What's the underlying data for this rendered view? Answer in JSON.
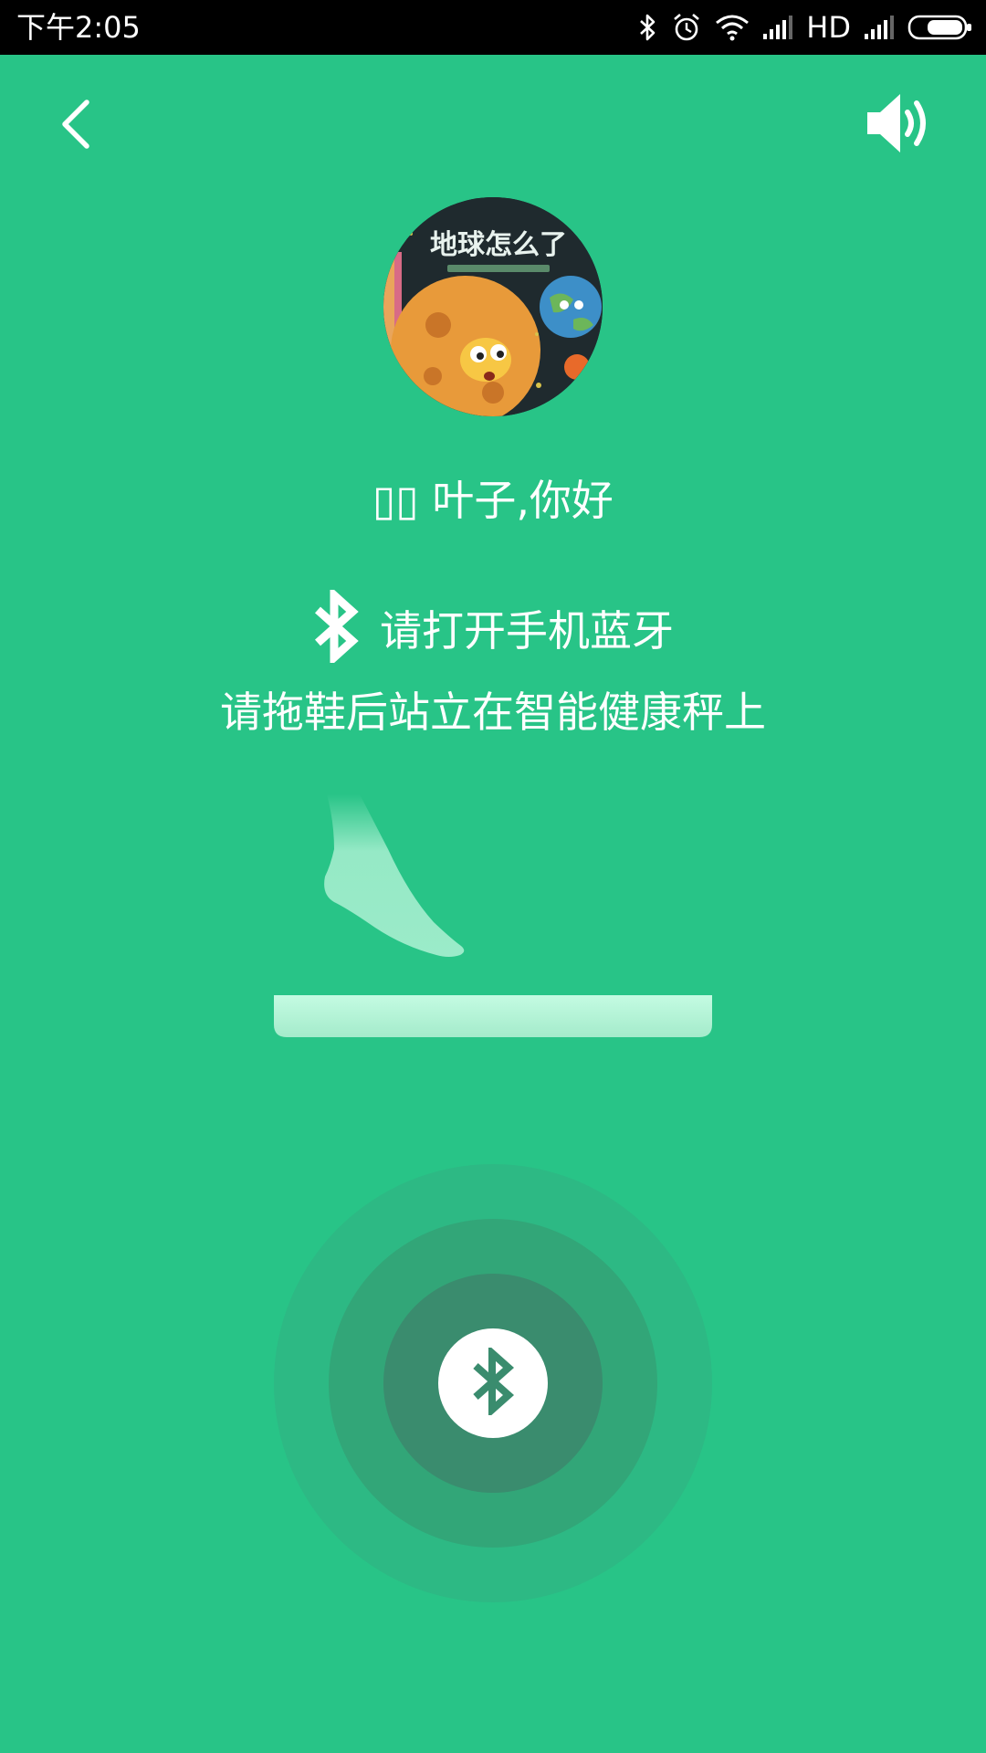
{
  "status_bar": {
    "time": "下午2:05",
    "network_label": "HD",
    "icons": [
      "bluetooth-icon",
      "alarm-icon",
      "wifi-icon",
      "signal-icon",
      "signal-icon",
      "battery-icon"
    ]
  },
  "nav": {
    "back_icon": "back-arrow-icon",
    "volume_icon": "speaker-icon"
  },
  "avatar": {
    "book_title": "地球怎么了"
  },
  "greeting": {
    "prefix": "▯▯",
    "text": "叶子,你好"
  },
  "bluetooth_prompt": {
    "icon": "bluetooth-icon",
    "text": "请打开手机蓝牙"
  },
  "instruction": "请拖鞋后站立在智能健康秤上",
  "center_button": {
    "icon": "bluetooth-icon"
  },
  "colors": {
    "background": "#28C487",
    "pulse_outer": "#2DB984",
    "pulse_middle": "#32A678",
    "pulse_inner": "#3A8C6E",
    "foot": "#9BEBC9",
    "scale": "#B5F5D8"
  }
}
